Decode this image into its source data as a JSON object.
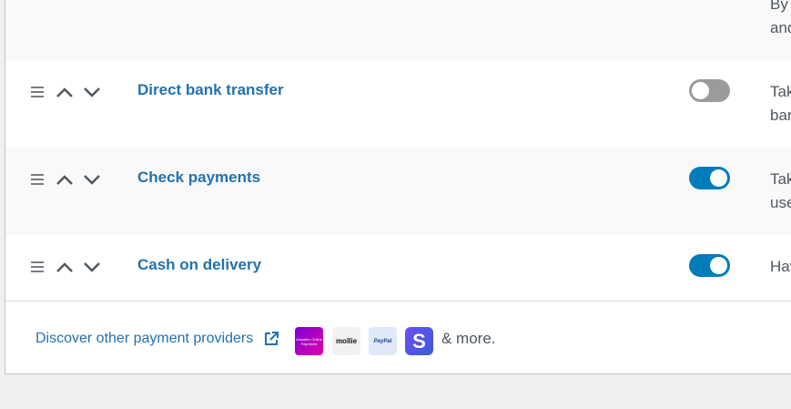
{
  "top_row": {
    "desc_line1": "By",
    "desc_line2": "and"
  },
  "methods": [
    {
      "name": "Direct bank transfer",
      "enabled": false,
      "desc_line1": "Tak",
      "desc_line2": "bar"
    },
    {
      "name": "Check payments",
      "enabled": true,
      "desc_line1": "Tak",
      "desc_line2": "use"
    },
    {
      "name": "Cash on delivery",
      "enabled": true,
      "desc_line1": "Hav",
      "desc_line2": ""
    }
  ],
  "footer": {
    "discover_label": "Discover other payment providers",
    "logos": {
      "airwallex": "Airwallex Online Payments",
      "mollie": "mollie",
      "paypal": "PayPal",
      "stripe": "S"
    },
    "more_label": "& more."
  },
  "colors": {
    "link": "#2271b1",
    "toggle_on": "#007cba",
    "toggle_off": "#9b9b9b"
  }
}
